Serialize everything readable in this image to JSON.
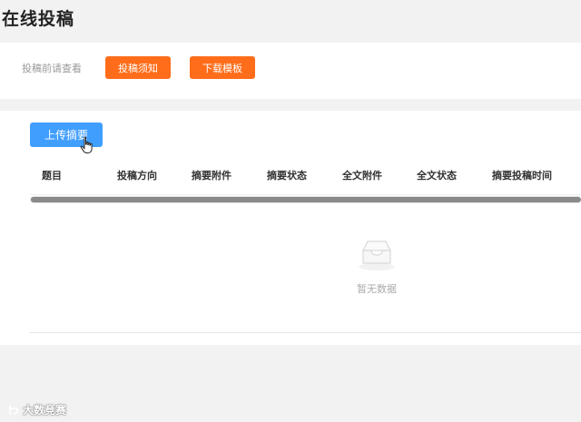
{
  "page": {
    "title": "在线投稿"
  },
  "top_panel": {
    "tip": "投稿前请查看",
    "notice_button": "投稿须知",
    "template_button": "下载模板"
  },
  "main_panel": {
    "upload_button": "上传摘要",
    "table": {
      "columns": [
        "题目",
        "投稿方向",
        "摘要附件",
        "摘要状态",
        "全文附件",
        "全文状态",
        "摘要投稿时间"
      ],
      "rows": [],
      "empty_text": "暂无数据"
    }
  },
  "watermark": {
    "text": "大数竞赛"
  },
  "colors": {
    "orange_button": "#ff6d1a",
    "blue_button": "#409eff",
    "background": "#f2f2f2"
  }
}
